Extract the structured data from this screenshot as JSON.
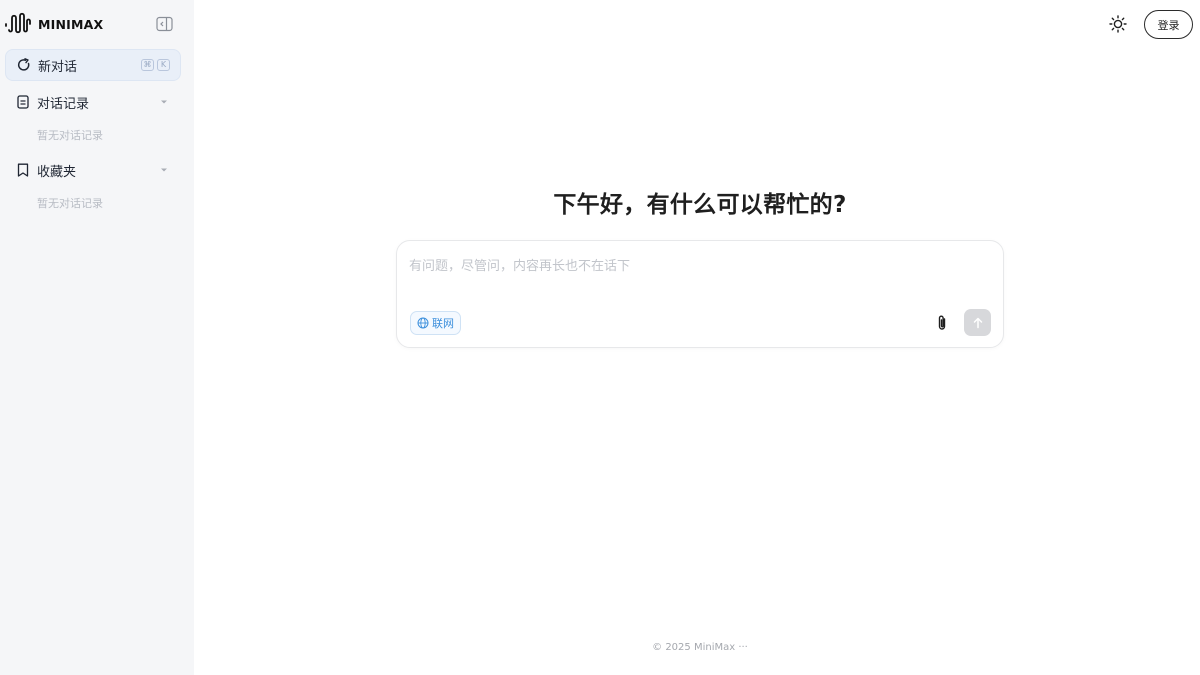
{
  "brand": {
    "name": "MINIMAX"
  },
  "sidebar": {
    "new_chat": {
      "label": "新对话",
      "shortcut": [
        "⌘",
        "K"
      ]
    },
    "history": {
      "label": "对话记录",
      "empty": "暂无对话记录"
    },
    "favorites": {
      "label": "收藏夹",
      "empty": "暂无对话记录"
    }
  },
  "header": {
    "login_label": "登录",
    "theme_icon": "sun-icon"
  },
  "main": {
    "greeting": "下午好，有什么可以帮忙的?",
    "input": {
      "placeholder": "有问题，尽管问，内容再长也不在话下",
      "value": "",
      "web_search_label": "联网",
      "attach_icon": "paperclip-icon",
      "send_icon": "arrow-up-icon"
    },
    "footer": "© 2025 MiniMax ···"
  },
  "colors": {
    "sidebar_bg": "#f5f6f8",
    "new_chat_bg": "#e9eff8",
    "accent": "#3c8fdc",
    "send_disabled": "#d7d8db"
  }
}
